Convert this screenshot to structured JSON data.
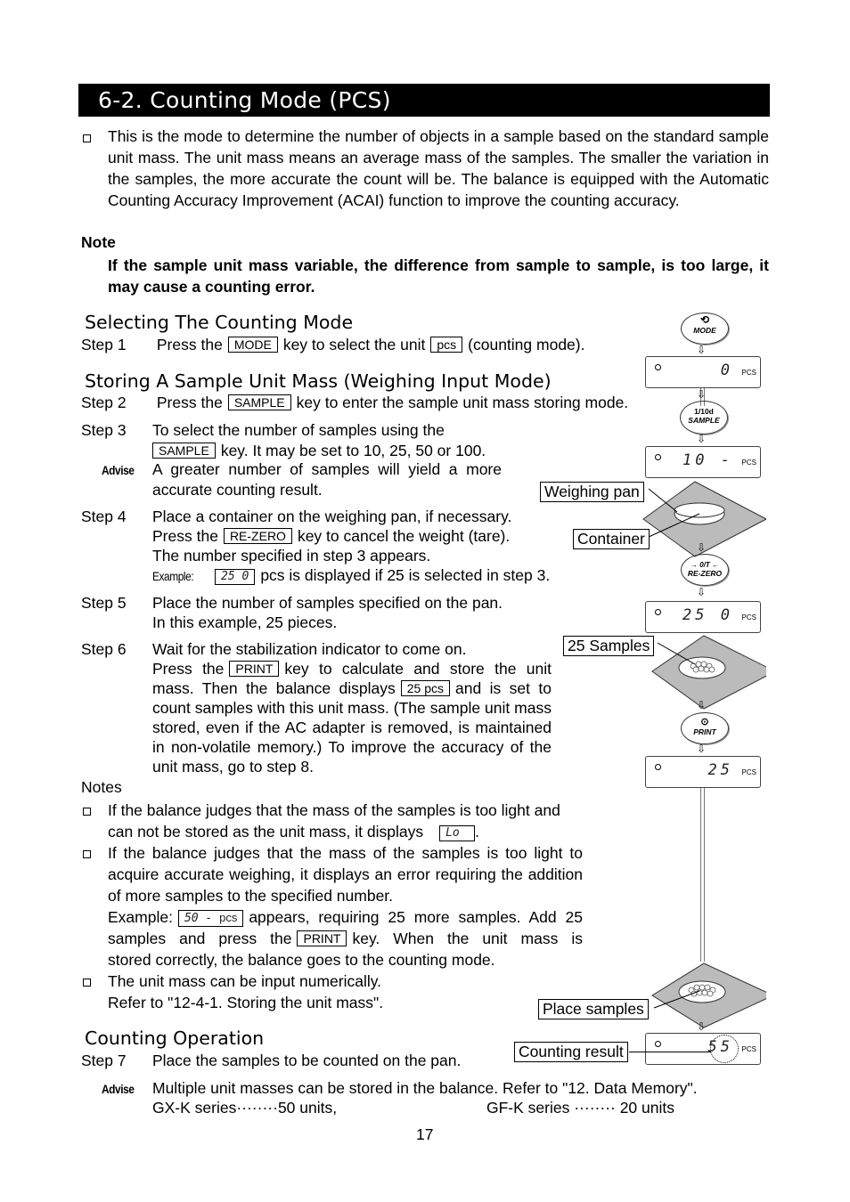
{
  "section_title": "6-2.  Counting Mode (PCS)",
  "intro": "This is the mode to determine the number of objects in a sample based on the standard sample unit mass. The unit mass means an average mass of the samples. The smaller the variation in the samples, the more accurate the count will be. The balance is equipped with the Automatic Counting Accuracy Improvement (ACAI) function to improve the counting accuracy.",
  "note": {
    "label": "Note",
    "text": "If the sample unit mass variable, the difference from sample to sample, is too large, it may cause a counting error."
  },
  "selecting": {
    "heading": "Selecting The Counting Mode",
    "step1": {
      "label": "Step   1",
      "pre": "Press the",
      "key": "MODE",
      "mid": "key to select the unit",
      "unit": "pcs",
      "post": "(counting mode)."
    }
  },
  "storing": {
    "heading": "Storing A Sample Unit Mass (Weighing Input Mode)",
    "step2": {
      "label": "Step   2",
      "pre": "Press the",
      "key": "SAMPLE",
      "post": "key to enter the sample unit mass storing mode."
    },
    "step3": {
      "label": "Step   3",
      "line1": "To select the number of samples using the",
      "key": "SAMPLE",
      "line2": "key. It may be set to 10, 25, 50 or 100."
    },
    "advise": {
      "label": "Advise",
      "line1": "A greater number of samples will yield a more",
      "line2": "accurate counting result."
    },
    "step4": {
      "label": "Step   4",
      "line1": "Place a container on the weighing pan, if necessary.",
      "pre2": "Press the",
      "key": "RE-ZERO",
      "post2": "key to cancel the weight (tare).",
      "line3": "The number specified in step 3 appears.",
      "example_label": "Example:",
      "example_lcd": "25  0",
      "example_post": "pcs is displayed if 25 is selected in step 3."
    },
    "step5": {
      "label": "Step   5",
      "line1": "Place the number of samples specified on the pan.",
      "line2": "In this example, 25 pieces."
    },
    "step6": {
      "label": "Step   6",
      "line1": "Wait for the stabilization indicator to come on.",
      "pre": "Press the",
      "key": "PRINT",
      "post": "key to calculate and store the unit",
      "pre2": "mass. Then the balance displays",
      "display": "25 pcs",
      "post2": "and is set to",
      "rest": "count samples with this unit mass. (The sample unit mass stored, even if the AC adapter is removed, is maintained in non-volatile memory.) To improve the accuracy of the unit mass, go to step 8."
    }
  },
  "notes": {
    "label": "Notes",
    "n1": {
      "line1": "If the balance judges that the mass of the samples is too light and",
      "pre2": "can not be stored as the unit mass, it displays",
      "lcd": "Lo",
      "post2": "."
    },
    "n2": {
      "text": "If the balance judges that the mass of the samples is too light to acquire accurate weighing, it displays an error requiring the addition of more samples to the specified number.",
      "example_label": "Example:",
      "example_lcd": "50 -",
      "example_unit": "pcs",
      "example_post": "appears, requiring 25 more samples. Add 25",
      "pre3": "samples and press the",
      "key": "PRINT",
      "post3": "key. When the unit mass is",
      "line4": "stored correctly, the balance goes to the counting mode."
    },
    "n3": {
      "line1": "The unit mass can be input numerically.",
      "line2": "Refer to \"12-4-1. Storing the unit mass\"."
    }
  },
  "counting": {
    "heading": "Counting Operation",
    "step7": {
      "label": "Step   7",
      "text": "Place the samples to be counted on the pan."
    },
    "advise": {
      "label": "Advise",
      "line1": "Multiple unit masses can be stored in the balance. Refer to \"12. Data Memory\".",
      "gx": "GX-K series········50 units,",
      "gf": "GF-K series ········ 20 units"
    }
  },
  "diagram": {
    "keys": {
      "mode": "MODE",
      "sample_top": "1/10d",
      "sample": "SAMPLE",
      "rezero_top": "→ 0/T ←",
      "rezero": "RE-ZERO",
      "print": "PRINT"
    },
    "lcd1": {
      "value": "0",
      "unit": "PCS"
    },
    "lcd2": {
      "value": "10  -",
      "unit": "PCS"
    },
    "lcd3": {
      "value": "25  0",
      "unit": "PCS"
    },
    "lcd4": {
      "value": "25",
      "unit": "PCS"
    },
    "lcd5": {
      "value": "55",
      "unit": "PCS"
    },
    "callouts": {
      "pan": "Weighing pan",
      "container": "Container",
      "samples25": "25 Samples",
      "place": "Place samples",
      "result": "Counting result"
    }
  },
  "page_number": "17"
}
